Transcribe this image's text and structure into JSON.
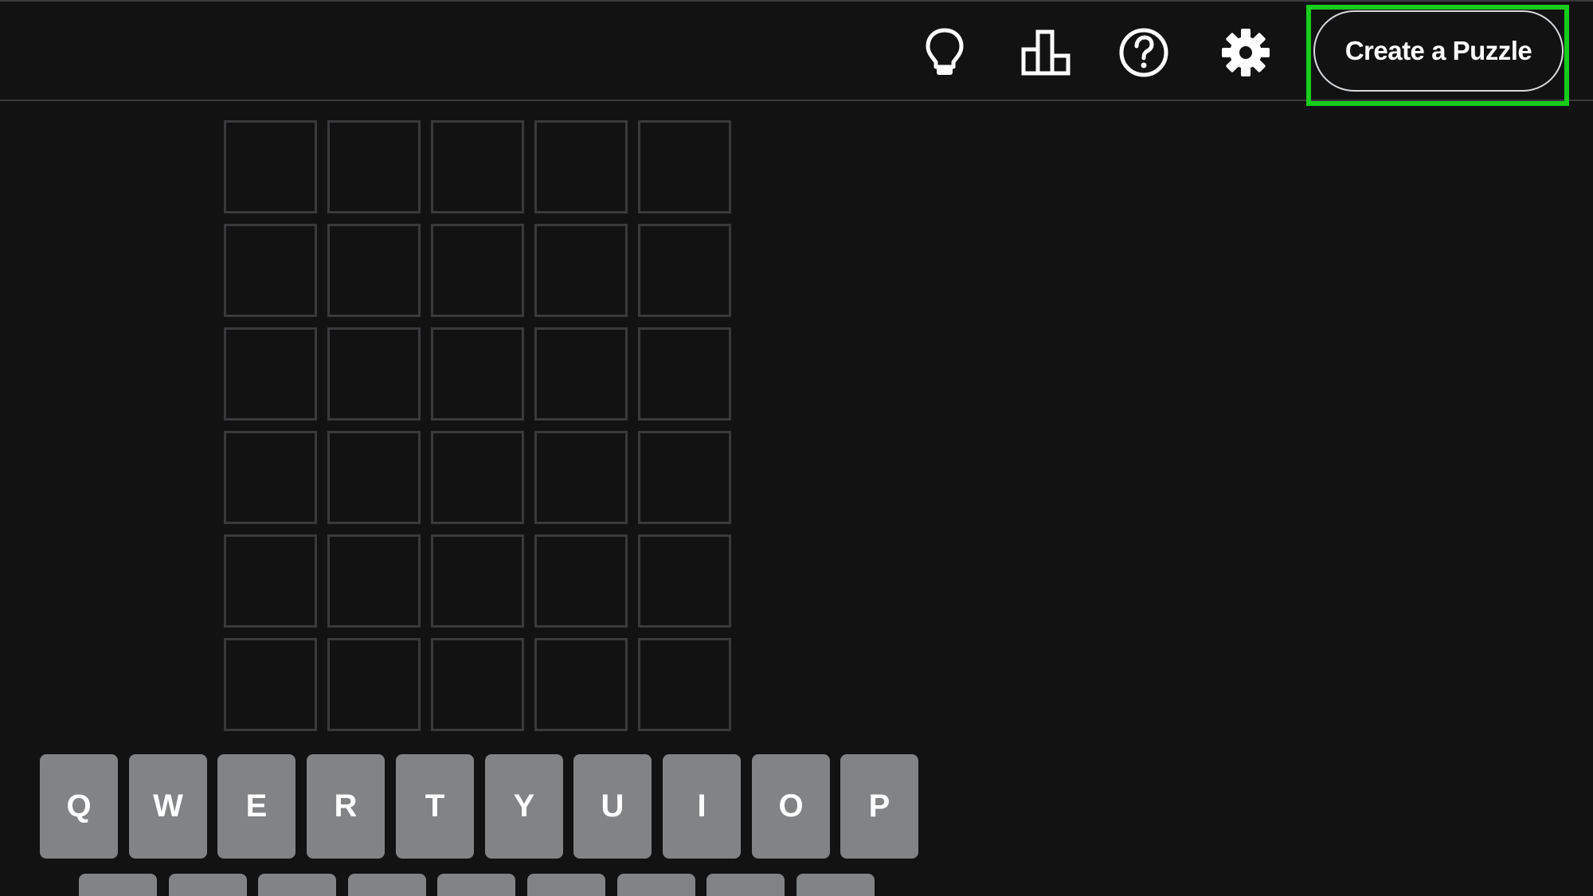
{
  "header": {
    "icons": {
      "hint": "lightbulb-icon",
      "stats": "bar-chart-icon",
      "help": "question-circle-icon",
      "settings": "gear-icon"
    },
    "create_label": "Create a Puzzle"
  },
  "board": {
    "rows": 6,
    "cols": 5
  },
  "keyboard": {
    "row1": [
      "Q",
      "W",
      "E",
      "R",
      "T",
      "Y",
      "U",
      "I",
      "O",
      "P"
    ],
    "row2": [
      "",
      "",
      "",
      "",
      "",
      "",
      "",
      "",
      ""
    ]
  },
  "colors": {
    "background": "#121213",
    "tile_border": "#3a3a3c",
    "key": "#818384",
    "highlight": "#16cc1c"
  }
}
